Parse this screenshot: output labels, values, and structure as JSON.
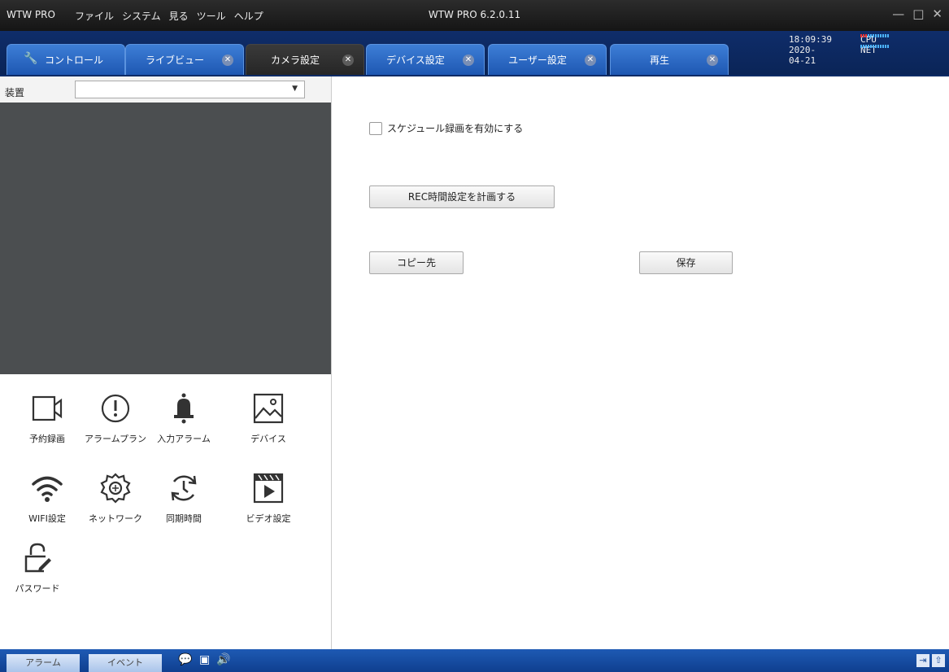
{
  "app": {
    "name": "WTW PRO",
    "window_title": "WTW PRO 6.2.0.11",
    "menu": [
      "ファイル",
      "システム",
      "見る",
      "ツール",
      "ヘルプ"
    ]
  },
  "tabs": [
    {
      "label": "コントロール"
    },
    {
      "label": "ライブビュー"
    },
    {
      "label": "カメラ設定"
    },
    {
      "label": "デバイス設定"
    },
    {
      "label": "ユーザー設定"
    },
    {
      "label": "再生"
    }
  ],
  "sysinfo": {
    "time": "18:09:39",
    "date": "2020-04-21",
    "cpu": "CPU",
    "net": "NET"
  },
  "device": {
    "label": "装置",
    "value": ""
  },
  "menu_icons": [
    {
      "label": "予約録画"
    },
    {
      "label": "アラームプラン"
    },
    {
      "label": "入力アラーム"
    },
    {
      "label": "デバイス"
    },
    {
      "label": "WIFI設定"
    },
    {
      "label": "ネットワーク"
    },
    {
      "label": "同期時間"
    },
    {
      "label": "ビデオ設定"
    },
    {
      "label": "パスワード"
    }
  ],
  "settings": {
    "schedule_checkbox_label": "スケジュール録画を有効にする",
    "schedule_enabled": false,
    "rec_button": "REC時間設定を計画する",
    "copy_button": "コピー先",
    "save_button": "保存"
  },
  "bottom": {
    "alarm_tab": "アラーム",
    "event_tab": "イベント"
  },
  "colors": {
    "tab_blue": "#2a69c4",
    "title_dark": "#1e1e1e",
    "bottom_blue": "#1a52a8"
  }
}
